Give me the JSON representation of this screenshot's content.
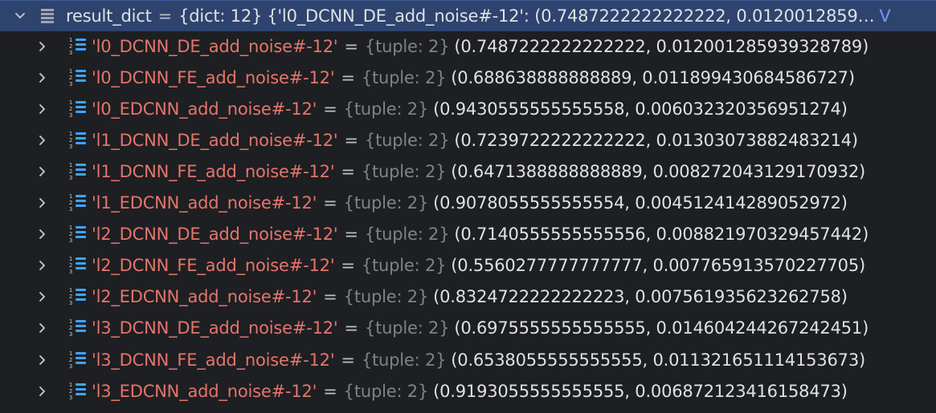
{
  "header": {
    "name": "result_dict",
    "equals": "=",
    "type": "{dict: 12}",
    "preview": "{'l0_DCNN_DE_add_noise#-12': (0.7487222222222222, 0.0120012859…",
    "view": "V"
  },
  "rows": [
    {
      "key": "'l0_DCNN_DE_add_noise#-12'",
      "type": "{tuple: 2}",
      "value": "(0.7487222222222222, 0.012001285939328789)"
    },
    {
      "key": "'l0_DCNN_FE_add_noise#-12'",
      "type": "{tuple: 2}",
      "value": "(0.688638888888889, 0.011899430684586727)"
    },
    {
      "key": "'l0_EDCNN_add_noise#-12'",
      "type": "{tuple: 2}",
      "value": "(0.9430555555555558, 0.006032320356951274)"
    },
    {
      "key": "'l1_DCNN_DE_add_noise#-12'",
      "type": "{tuple: 2}",
      "value": "(0.7239722222222222, 0.01303073882483214)"
    },
    {
      "key": "'l1_DCNN_FE_add_noise#-12'",
      "type": "{tuple: 2}",
      "value": "(0.6471388888888889, 0.008272043129170932)"
    },
    {
      "key": "'l1_EDCNN_add_noise#-12'",
      "type": "{tuple: 2}",
      "value": "(0.9078055555555554, 0.004512414289052972)"
    },
    {
      "key": "'l2_DCNN_DE_add_noise#-12'",
      "type": "{tuple: 2}",
      "value": "(0.7140555555555556, 0.008821970329457442)"
    },
    {
      "key": "'l2_DCNN_FE_add_noise#-12'",
      "type": "{tuple: 2}",
      "value": "(0.5560277777777777, 0.007765913570227705)"
    },
    {
      "key": "'l2_EDCNN_add_noise#-12'",
      "type": "{tuple: 2}",
      "value": "(0.8324722222222223, 0.007561935623262758)"
    },
    {
      "key": "'l3_DCNN_DE_add_noise#-12'",
      "type": "{tuple: 2}",
      "value": "(0.6975555555555555, 0.014604244267242451)"
    },
    {
      "key": "'l3_DCNN_FE_add_noise#-12'",
      "type": "{tuple: 2}",
      "value": "(0.6538055555555555, 0.011321651114153673)"
    },
    {
      "key": "'l3_EDCNN_add_noise#-12'",
      "type": "{tuple: 2}",
      "value": "(0.9193055555555555, 0.006872123416158473)"
    }
  ],
  "icons": {
    "expanded": "chevron-down-icon",
    "collapsed": "chevron-right-icon",
    "dict": "dict-icon",
    "tuple": "tuple-icon",
    "tuple_digits": "123"
  },
  "colors": {
    "background": "#1e1f22",
    "selected_row": "#2e436e",
    "key": "#e5756c",
    "type": "#7e8389",
    "text": "#dfe1e5",
    "icon_accent": "#3da5ff"
  }
}
